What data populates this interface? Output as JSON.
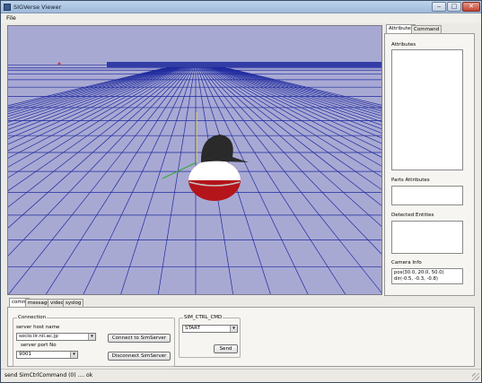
{
  "window": {
    "title": "SIGVerse Viewer",
    "min_glyph": "‒",
    "max_glyph": "□",
    "close_glyph": "✕"
  },
  "menu": {
    "file": "File"
  },
  "right_tabs": [
    "Attributes",
    "Command"
  ],
  "right_panel": {
    "attributes_label": "Attributes",
    "parts_label": "Parts Attributes",
    "detected_label": "Detected Entities",
    "camera_label": "Camera Info",
    "camera_pos": "pos(30.0, 20.0, 50.0)",
    "camera_dir": "dir(-0.5, -0.3, -0.8)"
  },
  "bottom_tabs": [
    "comm",
    "messages",
    "video",
    "syslog"
  ],
  "connection": {
    "title": "Connection",
    "host_label": "server host name",
    "host_value": "socio.iir.nii.ac.jp",
    "port_label": "server port No",
    "port_value": "9001",
    "connect_button": "Connect to SimServer",
    "disconnect_button": "Disconnect SimServer"
  },
  "sim_ctrl": {
    "title": "SIM_CTRL_CMD",
    "command_value": "START",
    "send_button": "Send"
  },
  "status": "send SimCtrlCommand (0) .... ok",
  "colors": {
    "viewport_bg": "#a8a9d3",
    "grid_line": "#1f2a9e",
    "robot_head": "#2a2a2a",
    "robot_top": "#ffffff",
    "robot_bottom": "#b3151b"
  },
  "icons": {
    "arrow_down": "▾"
  }
}
